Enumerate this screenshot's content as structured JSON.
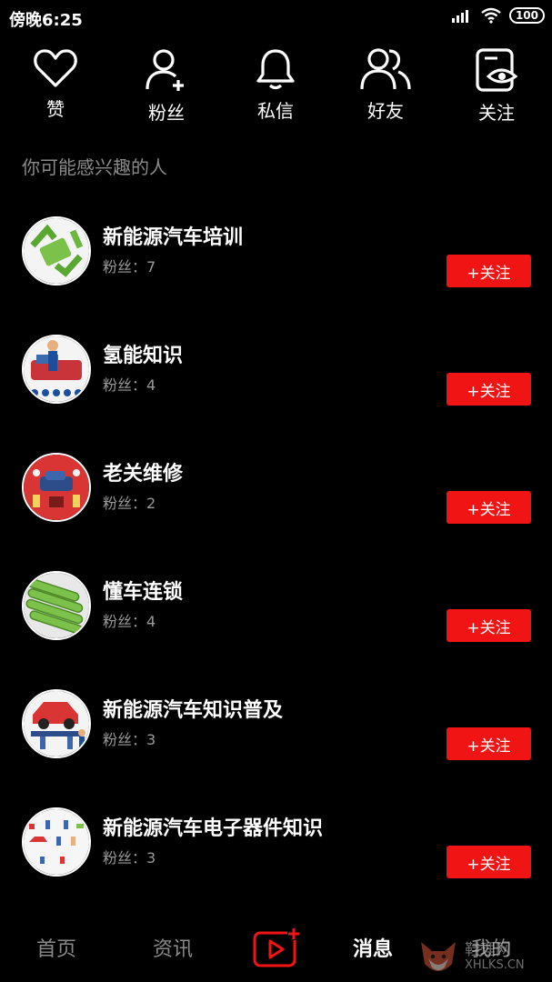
{
  "status": {
    "time": "傍晚6:25",
    "battery": "100"
  },
  "actions": [
    {
      "label": "赞",
      "icon": "heart-icon"
    },
    {
      "label": "粉丝",
      "icon": "user-plus-icon"
    },
    {
      "label": "私信",
      "icon": "bell-icon"
    },
    {
      "label": "好友",
      "icon": "users-icon"
    },
    {
      "label": "关注",
      "icon": "eye-card-icon"
    }
  ],
  "section_title": "你可能感兴趣的人",
  "suggestions": [
    {
      "name": "新能源汽车培训",
      "fans": "粉丝：7",
      "button": "+关注"
    },
    {
      "name": "氢能知识",
      "fans": "粉丝：4",
      "button": "+关注"
    },
    {
      "name": "老关维修",
      "fans": "粉丝：2",
      "button": "+关注"
    },
    {
      "name": "懂车连锁",
      "fans": "粉丝：4",
      "button": "+关注"
    },
    {
      "name": "新能源汽车知识普及",
      "fans": "粉丝：3",
      "button": "+关注"
    },
    {
      "name": "新能源汽车电子器件知识",
      "fans": "粉丝：3",
      "button": "+关注"
    }
  ],
  "tabs": [
    {
      "label": "首页"
    },
    {
      "label": "资讯"
    },
    {
      "label": "消息",
      "active": true
    },
    {
      "label": "我的"
    }
  ],
  "watermark": {
    "text": "鞋理网",
    "url": "XHLKS.CN"
  },
  "colors": {
    "accent": "#f01414",
    "background": "#000000",
    "muted": "#8a8a8a"
  }
}
